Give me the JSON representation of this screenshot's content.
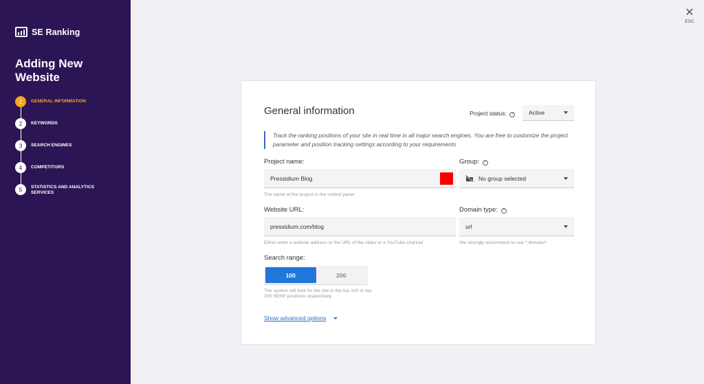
{
  "sidebar": {
    "brand": "SE Ranking",
    "title": "Adding New Website",
    "steps": [
      {
        "num": "1",
        "label": "GENERAL INFORMATION"
      },
      {
        "num": "2",
        "label": "KEYWORDS"
      },
      {
        "num": "3",
        "label": "SEARCH ENGINES"
      },
      {
        "num": "4",
        "label": "COMPETITORS"
      },
      {
        "num": "5",
        "label": "STATISTICS AND ANALYTICS SERVICES"
      }
    ]
  },
  "close": {
    "icon": "close-icon",
    "label": "ESC"
  },
  "form": {
    "title": "General information",
    "project_status_label": "Project status:",
    "project_status_value": "Active",
    "info_text": "Track the ranking positions of your site in real time in all major search engines. You are free to customize the project parameter and position tracking settings according to your requirements",
    "project_name_label": "Project name:",
    "project_name_value": "Pressidium Blog",
    "project_name_hint": "The name of the project in the control panel",
    "project_color": "#fb0000",
    "group_label": "Group:",
    "group_value": "No group selected",
    "website_url_label": "Website URL:",
    "website_url_value": "pressidium.com/blog",
    "website_url_hint": "Either enter a website address or the URL of the video or a YouTube channel",
    "domain_type_label": "Domain type:",
    "domain_type_value": "url",
    "domain_type_hint": "We strongly recommend to use *.domain/*",
    "search_range_label": "Search range:",
    "search_range_options": [
      "100",
      "200"
    ],
    "search_range_selected": "100",
    "search_range_hint": "The system will look for the site in the top 100 or top 200 SERP positions respectively",
    "advanced_label": "Show advanced options"
  },
  "colors": {
    "sidebar_bg": "#2b1555",
    "accent": "#f5a623",
    "primary": "#2176d9"
  }
}
